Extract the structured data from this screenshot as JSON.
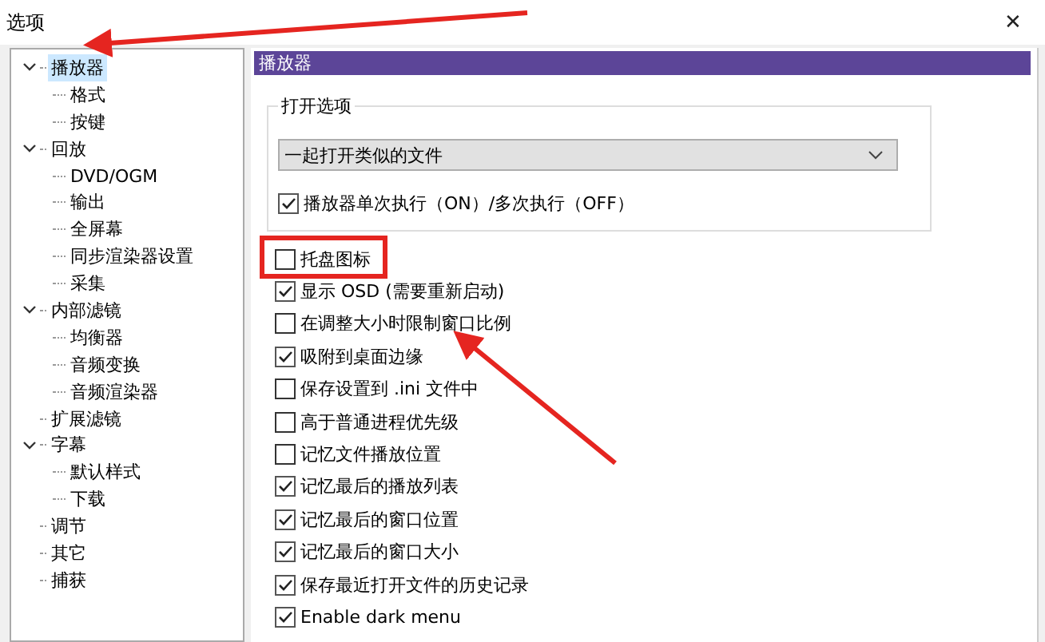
{
  "window": {
    "title": "选项",
    "close": "✕"
  },
  "tree": [
    {
      "label": "播放器",
      "expanded": true,
      "selected": true,
      "children": [
        {
          "label": "格式",
          "selected": false
        },
        {
          "label": "按键",
          "selected": false
        }
      ]
    },
    {
      "label": "回放",
      "expanded": true,
      "selected": false,
      "children": [
        {
          "label": "DVD/OGM",
          "selected": false
        },
        {
          "label": "输出",
          "selected": false
        },
        {
          "label": "全屏幕",
          "selected": false
        },
        {
          "label": "同步渲染器设置",
          "selected": false
        },
        {
          "label": "采集",
          "selected": false
        }
      ]
    },
    {
      "label": "内部滤镜",
      "expanded": true,
      "selected": false,
      "children": [
        {
          "label": "均衡器",
          "selected": false
        },
        {
          "label": "音频变换",
          "selected": false
        },
        {
          "label": "音频渲染器",
          "selected": false
        }
      ]
    },
    {
      "label": "扩展滤镜",
      "selected": false
    },
    {
      "label": "字幕",
      "expanded": true,
      "selected": false,
      "children": [
        {
          "label": "默认样式",
          "selected": false
        },
        {
          "label": "下载",
          "selected": false
        }
      ]
    },
    {
      "label": "调节",
      "selected": false
    },
    {
      "label": "其它",
      "selected": false
    },
    {
      "label": "捕获",
      "selected": false
    }
  ],
  "panel": {
    "title": "播放器",
    "group": {
      "label": "打开选项",
      "dropdown": {
        "value": "一起打开类似的文件"
      },
      "checkbox": {
        "label": "播放器单次执行（ON）/多次执行（OFF）",
        "checked": true
      }
    },
    "options": [
      {
        "label": "托盘图标",
        "checked": false
      },
      {
        "label": "显示 OSD (需要重新启动)",
        "checked": true
      },
      {
        "label": "在调整大小时限制窗口比例",
        "checked": false
      },
      {
        "label": "吸附到桌面边缘",
        "checked": true
      },
      {
        "label": "保存设置到 .ini 文件中",
        "checked": false
      },
      {
        "label": "高于普通进程优先级",
        "checked": false
      },
      {
        "label": "记忆文件播放位置",
        "checked": false
      },
      {
        "label": "记忆最后的播放列表",
        "checked": true
      },
      {
        "label": "记忆最后的窗口位置",
        "checked": true
      },
      {
        "label": "记忆最后的窗口大小",
        "checked": true
      },
      {
        "label": "保存最近打开文件的历史记录",
        "checked": true
      },
      {
        "label": "Enable dark menu",
        "checked": true
      }
    ]
  }
}
